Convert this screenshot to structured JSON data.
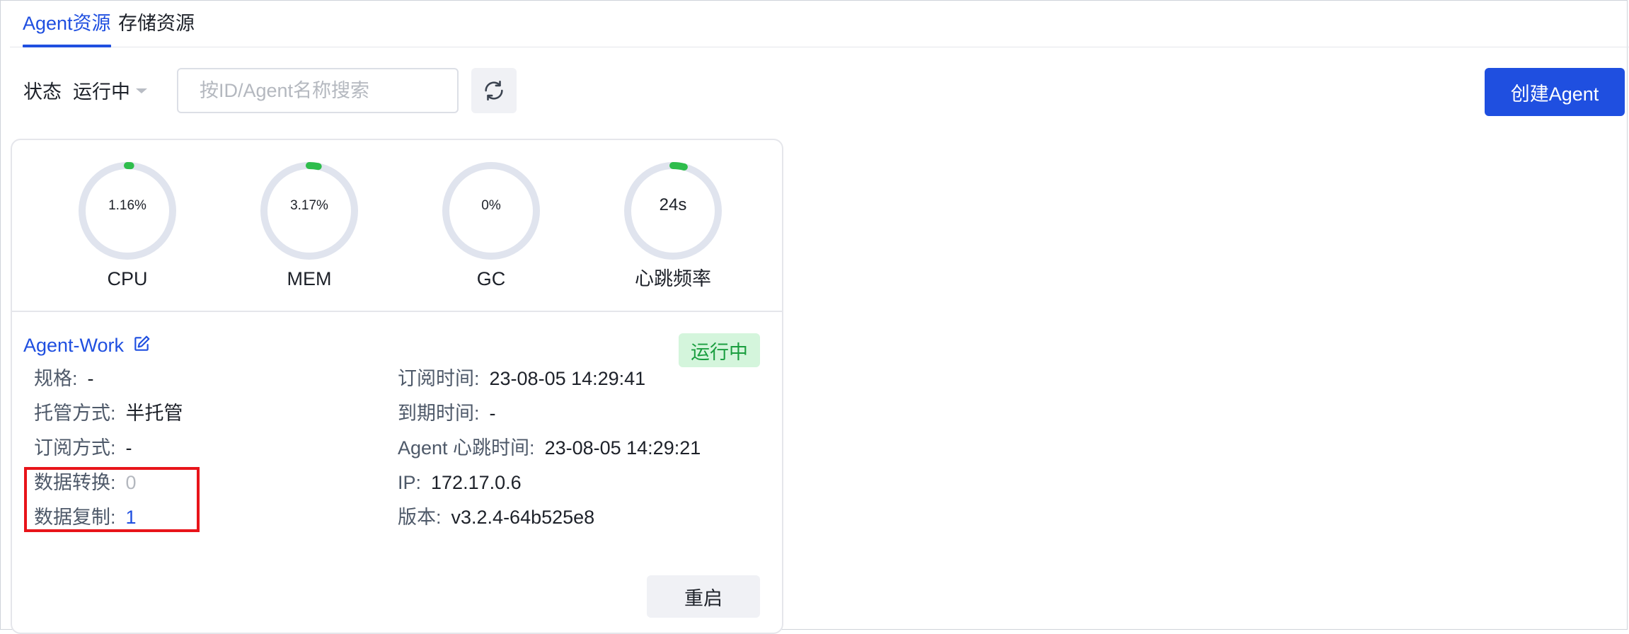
{
  "tabs": [
    {
      "label": "Agent资源",
      "active": true
    },
    {
      "label": "存储资源",
      "active": false
    }
  ],
  "toolbar": {
    "status_label": "状态",
    "status_value": "运行中",
    "search_placeholder": "按ID/Agent名称搜索",
    "search_value": "",
    "create_label": "创建Agent"
  },
  "gauges": [
    {
      "label": "CPU",
      "value": "1.16%",
      "fraction": 0.0116
    },
    {
      "label": "MEM",
      "value": "3.17%",
      "fraction": 0.0317
    },
    {
      "label": "GC",
      "value": "0%",
      "fraction": 0
    },
    {
      "label": "心跳频率",
      "value": "24s",
      "fraction": 0.04
    }
  ],
  "agent": {
    "name": "Agent-Work",
    "status": "运行中",
    "fields_left": [
      {
        "key": "规格:",
        "value": "-",
        "style": "normal"
      },
      {
        "key": "托管方式:",
        "value": "半托管",
        "style": "normal"
      },
      {
        "key": "订阅方式:",
        "value": "-",
        "style": "normal"
      },
      {
        "key": "数据转换:",
        "value": "0",
        "style": "muted"
      },
      {
        "key": "数据复制:",
        "value": "1",
        "style": "link"
      }
    ],
    "fields_right": [
      {
        "key": "订阅时间:",
        "value": "23-08-05 14:29:41"
      },
      {
        "key": "到期时间:",
        "value": "-"
      },
      {
        "key": "Agent 心跳时间:",
        "value": "23-08-05 14:29:21"
      },
      {
        "key": "IP:",
        "value": "172.17.0.6"
      },
      {
        "key": "版本:",
        "value": "v3.2.4-64b525e8"
      }
    ],
    "restart_label": "重启"
  },
  "colors": {
    "accent": "#1f4fe0",
    "gauge_track": "#e0e4ee",
    "gauge_fill": "#2ebd4c",
    "status_bg": "#d4f5dc",
    "status_text": "#1a9e3f",
    "highlight_border": "#e8141a"
  },
  "icons": {
    "refresh": "refresh-icon",
    "edit": "edit-icon"
  }
}
